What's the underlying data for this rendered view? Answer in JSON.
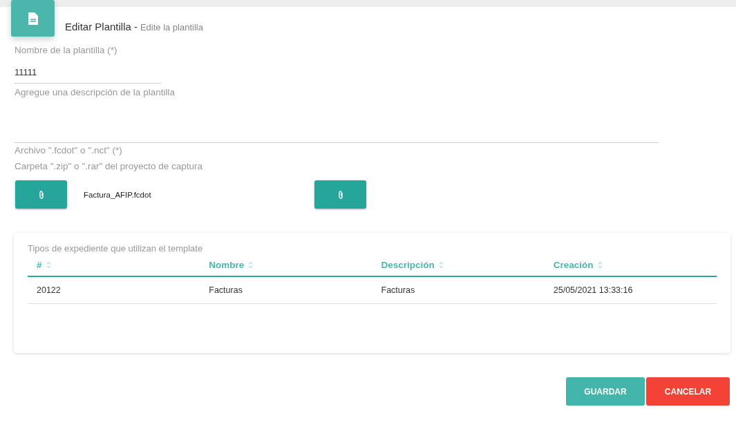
{
  "header": {
    "title": "Editar Plantilla",
    "separator": "-",
    "subtitle": "Edite la plantilla"
  },
  "name_field": {
    "label": "Nombre de la plantilla (*)",
    "value": "11111"
  },
  "description_field": {
    "placeholder": "Agregue una descripción de la plantilla"
  },
  "file_labels": [
    "Archivo \".fcdot\" o \".nct\" (*)",
    "Carpeta \".zip\" o \".rar\" del proyecto de captura"
  ],
  "file_name": "Factura_AFIP.fcdot",
  "table": {
    "title": "Tipos de expediente que utilizan el template",
    "columns": [
      "#",
      "Nombre",
      "Descripción",
      "Creación"
    ],
    "rows": [
      [
        "20122",
        "Facturas",
        "Facturas",
        "25/05/2021 13:33:16"
      ]
    ]
  },
  "buttons": [
    {
      "label": "GUARDAR",
      "kind": "primary"
    },
    {
      "label": "CANCELAR",
      "kind": "danger"
    }
  ]
}
